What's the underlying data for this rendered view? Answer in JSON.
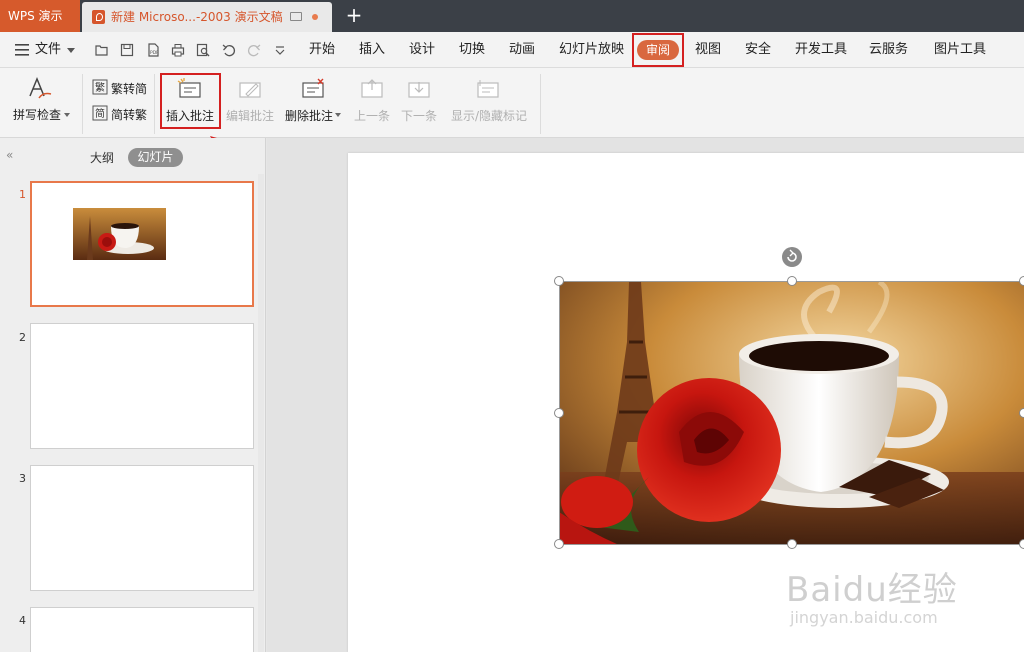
{
  "titlebar": {
    "app_name": "WPS 演示",
    "doc_title": "新建 Microso...-2003 演示文稿",
    "add_tab": "+"
  },
  "menubar": {
    "file_label": "文件",
    "items": [
      "开始",
      "插入",
      "设计",
      "切换",
      "动画",
      "幻灯片放映",
      "审阅",
      "视图",
      "安全",
      "开发工具",
      "云服务",
      "图片工具"
    ],
    "active": "审阅"
  },
  "ribbon": {
    "spellcheck": "拼写检查",
    "trad_to_simp": "繁转简",
    "simp_to_trad": "简转繁",
    "insert_comment": "插入批注",
    "edit_comment": "编辑批注",
    "delete_comment": "删除批注",
    "prev": "上一条",
    "next": "下一条",
    "show_hide_markup": "显示/隐藏标记"
  },
  "panel": {
    "outline_tab": "大纲",
    "slides_tab": "幻灯片",
    "collapse": "«",
    "slide_numbers": [
      "1",
      "2",
      "3",
      "4"
    ]
  },
  "watermark": {
    "brand": "Baidu经验",
    "url": "jingyan.baidu.com"
  },
  "colors": {
    "accent": "#d6562c",
    "highlight_box": "#d42020",
    "titlebar_bg": "#3b4047"
  }
}
